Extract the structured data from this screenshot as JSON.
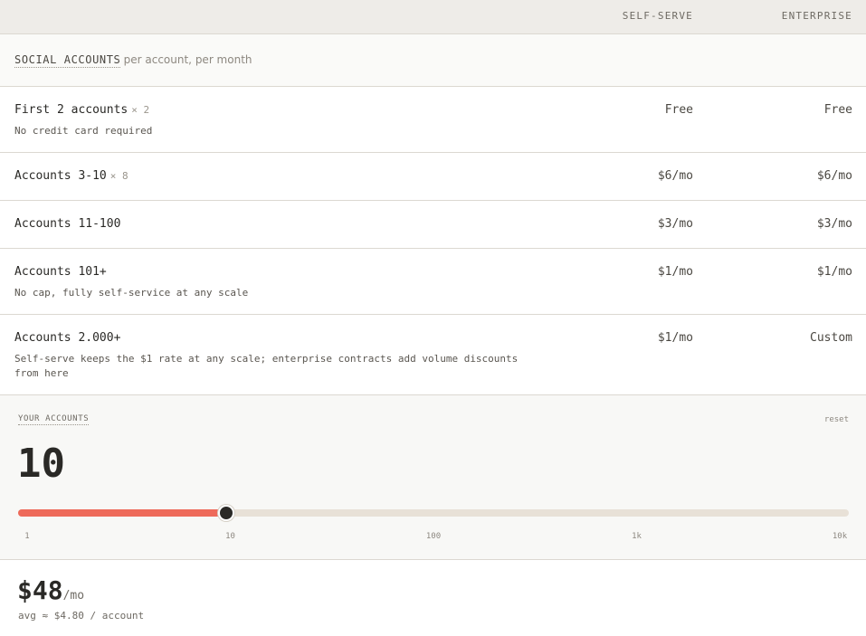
{
  "header": {
    "self_serve": "SELF-SERVE",
    "enterprise": "ENTERPRISE"
  },
  "section": {
    "title": "SOCIAL ACCOUNTS",
    "subtitle": "· per account, per month"
  },
  "tiers": [
    {
      "name": "First 2 accounts",
      "mult": "× 2",
      "note": "No credit card required",
      "self_serve": "Free",
      "enterprise": "Free"
    },
    {
      "name": "Accounts 3-10",
      "mult": "× 8",
      "note": "",
      "self_serve": "$6/mo",
      "enterprise": "$6/mo"
    },
    {
      "name": "Accounts 11-100",
      "mult": "",
      "note": "",
      "self_serve": "$3/mo",
      "enterprise": "$3/mo"
    },
    {
      "name": "Accounts 101+",
      "mult": "",
      "note": "No cap, fully self-service at any scale",
      "self_serve": "$1/mo",
      "enterprise": "$1/mo"
    },
    {
      "name": "Accounts 2.000+",
      "mult": "",
      "note": "Self-serve keeps the $1 rate at any scale; enterprise contracts add volume discounts from here",
      "self_serve": "$1/mo",
      "enterprise": "Custom"
    }
  ],
  "calculator": {
    "label": "YOUR ACCOUNTS",
    "reset_label": "reset",
    "count": "10",
    "slider_fraction": 0.25,
    "ticks": [
      "1",
      "10",
      "100",
      "1k",
      "10k"
    ],
    "fill_color": "#ee6a5a",
    "track_color": "#e8e1d7"
  },
  "total": {
    "price": "$48",
    "unit": "/mo",
    "avg": "avg ≈ $4.80 / account"
  }
}
